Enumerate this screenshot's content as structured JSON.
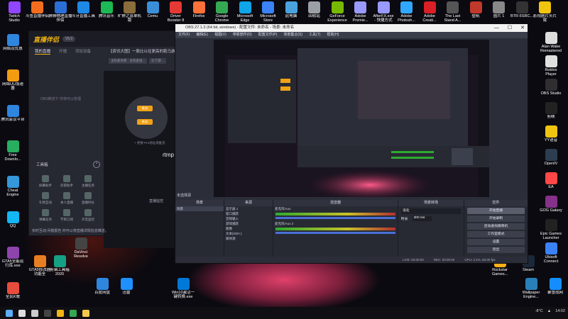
{
  "desktop": {
    "top_icons": [
      {
        "label": "Twitch\nStudio",
        "color": "#9146ff"
      },
      {
        "label": "斗鱼直播伴侣",
        "color": "#f46d1e"
      },
      {
        "label": "狮狮物理直播\n伴侣",
        "color": "#2a6fd6"
      },
      {
        "label": "斗牙直播工具",
        "color": "#1e88e5"
      },
      {
        "label": "腾讯音乐",
        "color": "#1db954"
      },
      {
        "label": "旷野之息单机\n版",
        "color": "#8a6d3b"
      },
      {
        "label": "Cemu",
        "color": "#3a8fd8"
      },
      {
        "label": "Driver\nBooster 8",
        "color": "#e53935"
      },
      {
        "label": "Firefox",
        "color": "#ff7139"
      },
      {
        "label": "Google\nChrome",
        "color": "#34a853"
      },
      {
        "label": "Microsoft\nEdge",
        "color": "#0ea5e9"
      },
      {
        "label": "Microsoft\nStore",
        "color": "#3b82f6"
      },
      {
        "label": "此电脑",
        "color": "#4aa3df"
      },
      {
        "label": "回收站",
        "color": "#9aa0a6"
      },
      {
        "label": "GeForce\nExperience",
        "color": "#76b900"
      },
      {
        "label": "Adobe\nPremie...",
        "color": "#9999ff"
      },
      {
        "label": "AfterFX.exe\n- 快捷方式",
        "color": "#9999ff"
      },
      {
        "label": "Adobe\nPhotosh...",
        "color": "#31a8ff"
      },
      {
        "label": "Adobe\nCreati...",
        "color": "#da1f26"
      },
      {
        "label": "The Last\nStand A...",
        "color": "#555"
      },
      {
        "label": "壁纸",
        "color": "#c0392b"
      },
      {
        "label": "图片 1",
        "color": "#888"
      },
      {
        "label": "BTR-5SRC...",
        "color": "#333"
      },
      {
        "label": "影视剧片头片\n尾",
        "color": "#f1c40f"
      }
    ],
    "left_icons": [
      {
        "label": "网络及优惠",
        "color": "#2e86de"
      },
      {
        "label": "网络UU加速\n器",
        "color": "#f39c12"
      },
      {
        "label": "腾讯会议平台",
        "color": "#2e86de"
      },
      {
        "label": "Free\nDownlo...",
        "color": "#27ae60"
      },
      {
        "label": "Cheat\nEngine",
        "color": "#3498db"
      },
      {
        "label": "QQ",
        "color": "#12b7f5"
      },
      {
        "label": "GTA5全能运\n行库.exe",
        "color": "#8e44ad"
      },
      {
        "label": "全民K歌",
        "color": "#e74c3c"
      }
    ],
    "right_icons": [
      {
        "label": "Alan Wake\nRemastered",
        "color": "#ddd"
      },
      {
        "label": "Roblox\nPlayer",
        "color": "#e0e0e0"
      },
      {
        "label": "OBS Studio",
        "color": "#302e31"
      },
      {
        "label": "剪映",
        "color": "#222"
      },
      {
        "label": "YY语音",
        "color": "#f1c40f"
      },
      {
        "label": "OpenIV",
        "color": "#2c3e50"
      },
      {
        "label": "EA",
        "color": "#ff4747"
      },
      {
        "label": "GOG Galaxy",
        "color": "#86328a"
      },
      {
        "label": "Epic Games\nLauncher",
        "color": "#222"
      },
      {
        "label": "Ubisoft\nConnect",
        "color": "#3b82f6"
      }
    ],
    "bottom_icons": [
      {
        "label": "GTA5修改器\n功能全",
        "color": "#e67e22"
      },
      {
        "label": "剪辑工具箱\n2020",
        "color": "#16a085"
      },
      {
        "label": "DaVinci\nResolve",
        "color": "#444"
      },
      {
        "label": "百度网盘",
        "color": "#2e86de"
      },
      {
        "label": "迅雷",
        "color": "#1e90ff"
      },
      {
        "label": "Win10激活一\n键转换.exe",
        "color": "#0078d7"
      },
      {
        "label": "Rockstar\nGames...",
        "color": "#fcaf17"
      },
      {
        "label": "Steam",
        "color": "#1b2838"
      },
      {
        "label": "Wallpaper\nEngine...",
        "color": "#2980b9"
      },
      {
        "label": "暴雪战网",
        "color": "#148eff"
      }
    ]
  },
  "live_app": {
    "logo": "直播伴侣",
    "version": "V5.0",
    "tabs": [
      "我的直播",
      "开播",
      "添加设备"
    ],
    "news": "【资讯大图】一股比以往更高的跑马游...",
    "scene_tabs": [
      "主机麦场景 · 主机麦组...",
      "比下游..."
    ],
    "obs_note": "OBS推流下  你将可以管理",
    "node_top": "推流",
    "node_bottom": "推流",
    "add_hint": "+ 更换 Pro地址或推流",
    "toolbox_label": "工具箱",
    "tools": [
      "屏幕助手",
      "房管助手",
      "主播任务",
      "礼物互动",
      "本人直播",
      "直播时长",
      "弹幕任务",
      "节目订阅",
      "声音监控"
    ],
    "footer": "实时互动:问题报告 你可以将直播详情信息推送。",
    "rtmp_text": "rtmp",
    "rtmp_sub": "直播监控"
  },
  "obs": {
    "title": "OBS 27.1.3 (64 bit, windows) - 配置文件: 未命名 - 场景: 未命名",
    "window_controls": [
      "—",
      "☐",
      "✕"
    ],
    "menu": [
      "文件(F)",
      "编辑(E)",
      "视图(V)",
      "停靠部件(D)",
      "配置文件(P)",
      "场景集合(S)",
      "工具(T)",
      "帮助(H)"
    ],
    "selected_source_bar": "未选择源",
    "docks": {
      "scenes": {
        "title": "场景",
        "items": [
          "场景"
        ]
      },
      "sources": {
        "title": "来源",
        "items": [
          "显示器 1",
          "窗口捕获",
          "音频输入",
          "游戏捕获",
          "图像",
          "文本(GDI+)",
          "媒体源"
        ]
      },
      "mixer": {
        "title": "混音器",
        "channels": [
          {
            "name": "麦克风/Aux",
            "level": "0.0 dB"
          },
          {
            "name": "麦克风/Aux 2",
            "level": "0.0 dB"
          }
        ]
      },
      "transitions": {
        "title": "场景转场",
        "type": "淡化",
        "duration_label": "时长",
        "duration": "300 ms"
      },
      "controls": {
        "title": "控件",
        "buttons": [
          "开始直播",
          "开始录制",
          "启动虚拟摄像机",
          "工作室模式",
          "设置",
          "退出"
        ]
      }
    },
    "status": {
      "live": "LIVE: 00:00:00",
      "rec": "REC: 00:00:00",
      "cpu": "CPU: 3.1%, 60.00 fps"
    }
  },
  "taskbar": {
    "temperature": "-8°C",
    "time": "14:02",
    "icons": [
      {
        "name": "start",
        "color": "#5ab0ff"
      },
      {
        "name": "search",
        "color": "#ddd"
      },
      {
        "name": "task-view",
        "color": "#ccc"
      },
      {
        "name": "obs",
        "color": "#444"
      },
      {
        "name": "live",
        "color": "#f0b414"
      },
      {
        "name": "chrome",
        "color": "#34a853"
      },
      {
        "name": "explorer",
        "color": "#f2c94c"
      }
    ]
  },
  "colors": {
    "accent": "#f0b414",
    "obs_bg": "#2b2e38",
    "preview_pink": "#e0406a"
  }
}
